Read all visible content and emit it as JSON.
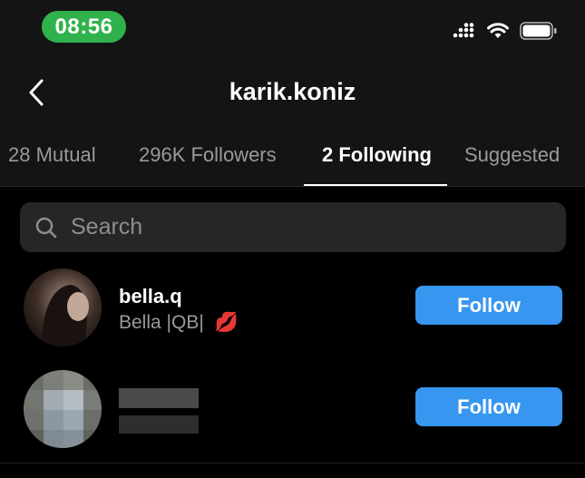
{
  "status_bar": {
    "time": "08:56"
  },
  "header": {
    "title": "karik.koniz"
  },
  "tabs": [
    {
      "label": "28 Mutual",
      "active": false
    },
    {
      "label": "296K Followers",
      "active": false
    },
    {
      "label": "2 Following",
      "active": true
    },
    {
      "label": "Suggested",
      "active": false
    }
  ],
  "search": {
    "placeholder": "Search"
  },
  "users": [
    {
      "username": "bella.q",
      "full_name": "Bella |QB|",
      "emoji": "💋",
      "button_label": "Follow"
    },
    {
      "username": "",
      "full_name": "",
      "blurred": true,
      "button_label": "Follow"
    }
  ],
  "colors": {
    "accent": "#3797f0",
    "time_pill": "#2fb24c",
    "background": "#000000"
  }
}
